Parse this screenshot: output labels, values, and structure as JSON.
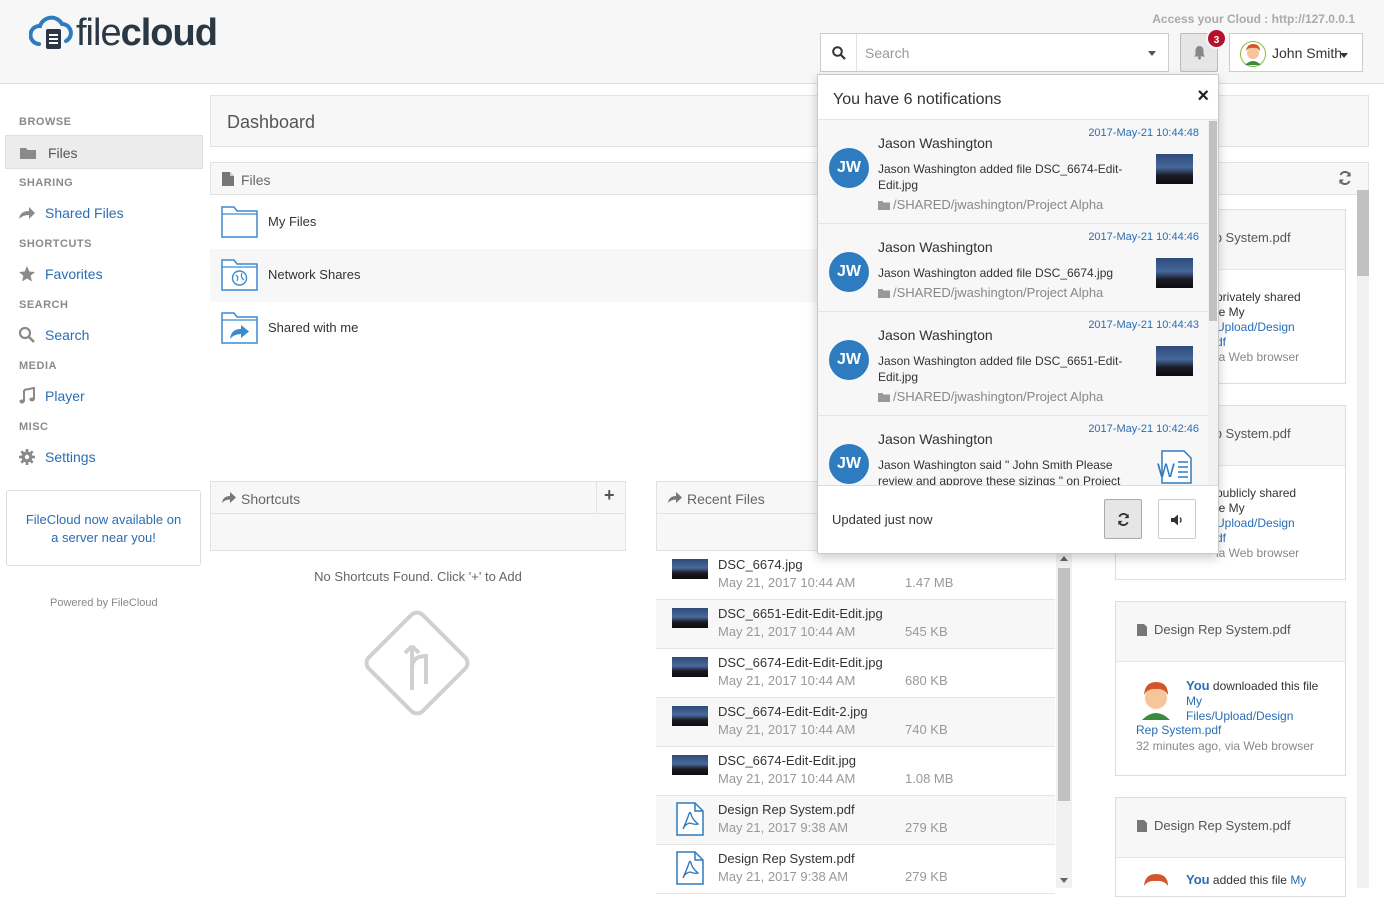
{
  "header": {
    "logo": {
      "light": "file",
      "bold": "cloud"
    },
    "access_text": "Access your Cloud : http://127.0.0.1",
    "search": {
      "placeholder": "Search"
    },
    "notification_badge": "3",
    "user_name": "John Smith"
  },
  "sidebar": {
    "sections": {
      "browse": "BROWSE",
      "sharing": "SHARING",
      "shortcuts": "SHORTCUTS",
      "search": "SEARCH",
      "media": "MEDIA",
      "misc": "MISC"
    },
    "items": {
      "files": "Files",
      "shared_files": "Shared Files",
      "favorites": "Favorites",
      "search": "Search",
      "player": "Player",
      "settings": "Settings"
    },
    "promo": "FileCloud now available on a server near you!",
    "powered": "Powered by FileCloud"
  },
  "main": {
    "title": "Dashboard",
    "files_panel": {
      "title": "Files",
      "rows": [
        "My Files",
        "Network Shares",
        "Shared with me"
      ]
    },
    "shortcuts_panel": {
      "title": "Shortcuts",
      "add": "+",
      "empty": "No Shortcuts Found. Click '+' to Add"
    },
    "recent_panel": {
      "title": "Recent Files",
      "rows": [
        {
          "name": "DSC_6674.jpg",
          "date": "May 21, 2017 10:44 AM",
          "size": "1.47 MB",
          "type": "image"
        },
        {
          "name": "DSC_6651-Edit-Edit-Edit.jpg",
          "date": "May 21, 2017 10:44 AM",
          "size": "545 KB",
          "type": "image"
        },
        {
          "name": "DSC_6674-Edit-Edit-Edit.jpg",
          "date": "May 21, 2017 10:44 AM",
          "size": "680 KB",
          "type": "image"
        },
        {
          "name": "DSC_6674-Edit-Edit-2.jpg",
          "date": "May 21, 2017 10:44 AM",
          "size": "740 KB",
          "type": "image"
        },
        {
          "name": "DSC_6674-Edit-Edit.jpg",
          "date": "May 21, 2017 10:44 AM",
          "size": "1.08 MB",
          "type": "image"
        },
        {
          "name": "Design Rep System.pdf",
          "date": "May 21, 2017 9:38 AM",
          "size": "279 KB",
          "type": "pdf"
        },
        {
          "name": "Design Rep System.pdf",
          "date": "May 21, 2017 9:38 AM",
          "size": "279 KB",
          "type": "pdf"
        }
      ]
    }
  },
  "activity": {
    "cards": [
      {
        "title": "Design Rep System.pdf",
        "line1": "privately shared",
        "line2": "le My",
        "link": "Upload/Design",
        "line3": "df",
        "meta": "ia Web browser"
      },
      {
        "title": "Design Rep System.pdf",
        "line1": "publicly shared",
        "line2": "le My",
        "link": "Upload/Design",
        "line3": "df",
        "meta": "ia Web browser"
      },
      {
        "title": "Design Rep System.pdf",
        "you": "You",
        "action": " downloaded this file ",
        "link1": "My",
        "link2": "Files/Upload/Design",
        "link3": "Rep System.pdf",
        "meta": "32 minutes ago, via Web browser"
      },
      {
        "title": "Design Rep System.pdf",
        "you": "You",
        "action": " added this file ",
        "link1": "My"
      }
    ]
  },
  "notifications": {
    "title": "You have 6 notifications",
    "close": "×",
    "items": [
      {
        "initials": "JW",
        "name": "Jason Washington",
        "time": "2017-May-21 10:44:48",
        "message": "Jason Washington added file DSC_6674-Edit-Edit.jpg",
        "path": "/SHARED/jwashington/Project Alpha"
      },
      {
        "initials": "JW",
        "name": "Jason Washington",
        "time": "2017-May-21 10:44:46",
        "message": "Jason Washington added file DSC_6674.jpg",
        "path": "/SHARED/jwashington/Project Alpha"
      },
      {
        "initials": "JW",
        "name": "Jason Washington",
        "time": "2017-May-21 10:44:43",
        "message": "Jason Washington added file DSC_6651-Edit-Edit.jpg",
        "path": "/SHARED/jwashington/Project Alpha"
      },
      {
        "initials": "JW",
        "name": "Jason Washington",
        "time": "2017-May-21 10:42:46",
        "message": "Jason Washington said \" John Smith Please review and approve these sizings \" on Project",
        "path": ""
      }
    ],
    "updated": "Updated just now"
  },
  "colors": {
    "accent": "#2a6db5",
    "avatar": "#2e7bbf",
    "badge": "#b5122a"
  },
  "icons": [
    "cloud-logo-icon",
    "search-icon",
    "bell-icon",
    "user-avatar-icon",
    "folder-icon",
    "share-icon",
    "star-icon",
    "music-icon",
    "gear-icon",
    "file-icon",
    "refresh-icon",
    "speaker-icon",
    "close-icon",
    "pdf-icon",
    "word-icon"
  ]
}
